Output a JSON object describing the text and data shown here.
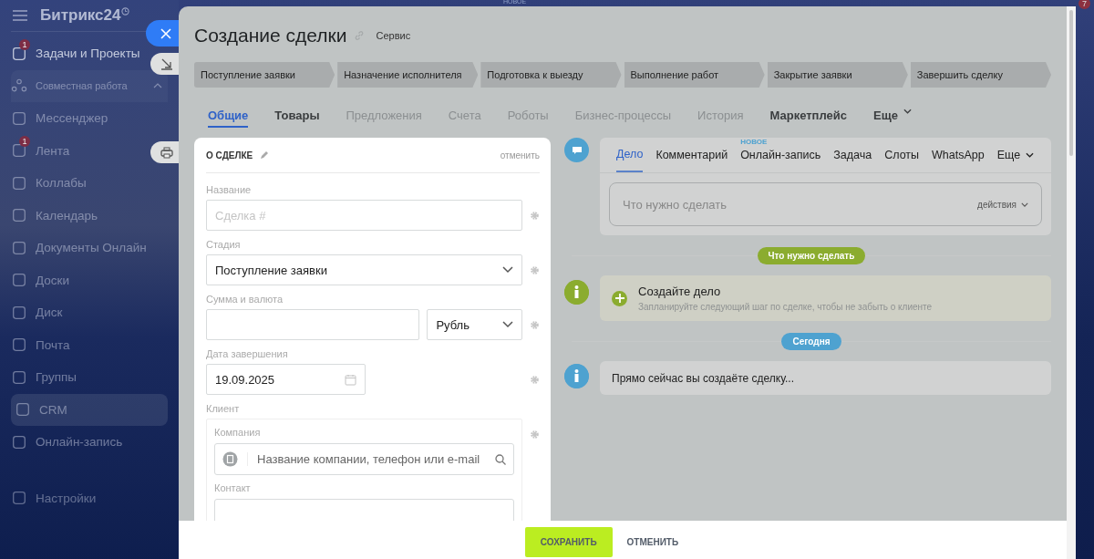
{
  "sidebar": {
    "logo": "Битрикс24",
    "items": [
      {
        "label": "Задачи и Проекты",
        "badge": "1",
        "kind": "item",
        "selected": false
      },
      {
        "label": "Совместная работа",
        "kind": "group",
        "expanded": true
      },
      {
        "label": "Мессенджер",
        "kind": "item",
        "selected": false
      },
      {
        "label": "Лента",
        "badge": "1",
        "kind": "item",
        "selected": false
      },
      {
        "label": "Коллабы",
        "kind": "item",
        "selected": false
      },
      {
        "label": "Календарь",
        "kind": "item",
        "selected": false
      },
      {
        "label": "Документы Онлайн",
        "kind": "item",
        "selected": false
      },
      {
        "label": "Доски",
        "kind": "item",
        "selected": false
      },
      {
        "label": "Диск",
        "kind": "item",
        "selected": false
      },
      {
        "label": "Почта",
        "kind": "item",
        "selected": false
      },
      {
        "label": "Группы",
        "kind": "item",
        "selected": false
      },
      {
        "label": "CRM",
        "kind": "item",
        "selected": true
      },
      {
        "label": "Онлайн-запись",
        "kind": "item",
        "selected": false
      },
      {
        "label": "Настройки",
        "kind": "item",
        "selected": false
      }
    ]
  },
  "background": {
    "new_label": "НОВОЕ",
    "badge": "7"
  },
  "slider": {
    "title": "Создание сделки",
    "category": "Сервис",
    "stages": [
      "Поступление заявки",
      "Назначение исполнителя",
      "Подготовка к выезду",
      "Выполнение работ",
      "Закрытие заявки",
      "Завершить сделку"
    ],
    "tabs": [
      {
        "label": "Общие",
        "selected": true,
        "disabled": false
      },
      {
        "label": "Товары",
        "selected": false,
        "disabled": false
      },
      {
        "label": "Предложения",
        "selected": false,
        "disabled": true
      },
      {
        "label": "Счета",
        "selected": false,
        "disabled": true
      },
      {
        "label": "Роботы",
        "selected": false,
        "disabled": true
      },
      {
        "label": "Бизнес-процессы",
        "selected": false,
        "disabled": true
      },
      {
        "label": "История",
        "selected": false,
        "disabled": true
      },
      {
        "label": "Маркетплейс",
        "selected": false,
        "disabled": false
      },
      {
        "label": "Еще",
        "selected": false,
        "disabled": false,
        "dropdown": true
      }
    ]
  },
  "form": {
    "section": "О СДЕЛКЕ",
    "cancel": "отменить",
    "name": {
      "label": "Название",
      "placeholder": "Сделка #"
    },
    "stage": {
      "label": "Стадия",
      "value": "Поступление заявки"
    },
    "amount": {
      "label": "Сумма и валюта",
      "currency": "Рубль"
    },
    "close_date": {
      "label": "Дата завершения",
      "value": "19.09.2025"
    },
    "client": {
      "label": "Клиент",
      "company_label": "Компания",
      "company_placeholder": "Название компании, телефон или e-mail",
      "contact_label": "Контакт"
    }
  },
  "timeline": {
    "tabs": [
      {
        "label": "Дело",
        "selected": true
      },
      {
        "label": "Комментарий",
        "selected": false
      },
      {
        "label": "Онлайн-запись",
        "selected": false,
        "badge": "НОВОЕ"
      },
      {
        "label": "Задача",
        "selected": false
      },
      {
        "label": "Слоты",
        "selected": false
      },
      {
        "label": "WhatsApp",
        "selected": false
      },
      {
        "label": "Еще",
        "selected": false,
        "dropdown": true
      }
    ],
    "input_placeholder": "Что нужно сделать",
    "actions": "действия",
    "todo_pill": "Что нужно сделать",
    "create": {
      "title": "Создайте дело",
      "hint": "Запланируйте следующий шаг по сделке, чтобы не забыть о клиенте"
    },
    "today_pill": "Сегодня",
    "note": "Прямо сейчас вы создаёте сделку..."
  },
  "footer": {
    "save": "СОХРАНИТЬ",
    "cancel": "ОТМЕНИТЬ"
  }
}
